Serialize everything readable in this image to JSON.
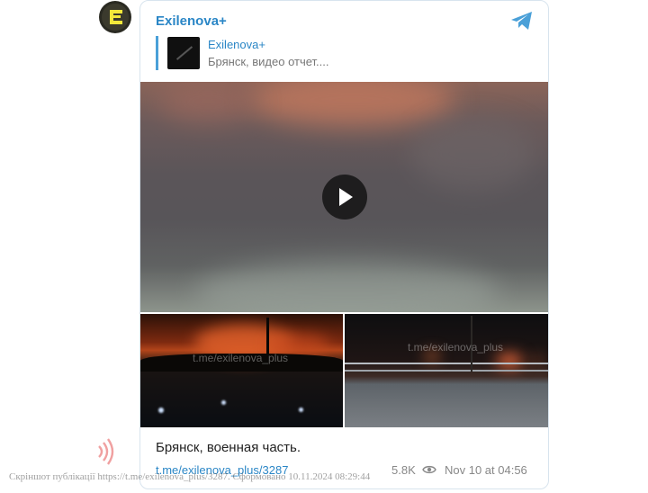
{
  "channel": {
    "name": "Exilenova+",
    "avatar_icon": "exilenova-logo-icon",
    "brand_color": "#2a86c6"
  },
  "reply": {
    "name": "Exilenova+",
    "text": "Брянск, видео отчет...."
  },
  "media": {
    "video_play_icon": "play-icon",
    "photo_watermark_1": "t.me/exilenova_plus",
    "photo_watermark_2": "t.me/exilenova_plus"
  },
  "post": {
    "caption": "Брянск, военная часть.",
    "link": "t.me/exilenova_plus/3287",
    "views": "5.8K",
    "timestamp": "Nov 10 at 04:56"
  },
  "footer": {
    "note": "Скріншот публікації https://t.me/exilenova_plus/3287. Сформовано 10.11.2024 08:29:44"
  }
}
